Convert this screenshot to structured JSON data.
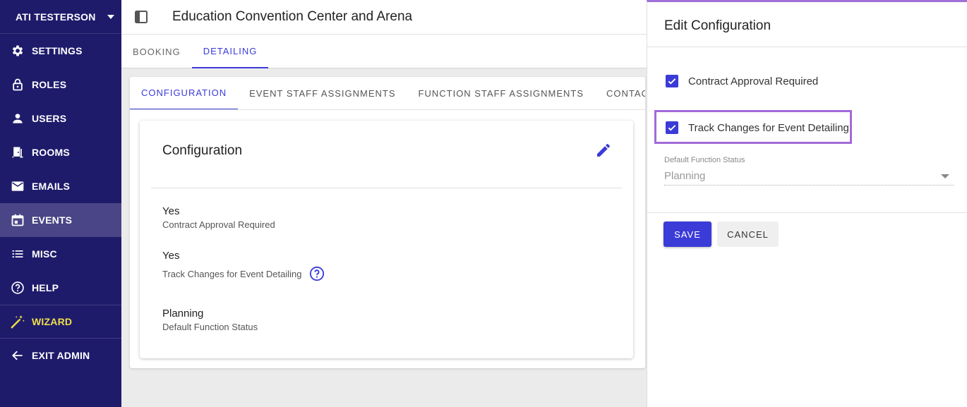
{
  "sidebar": {
    "user_name": "ATI TESTERSON",
    "items": [
      {
        "label": "SETTINGS",
        "icon": "gear-icon"
      },
      {
        "label": "ROLES",
        "icon": "lock-icon"
      },
      {
        "label": "USERS",
        "icon": "person-icon"
      },
      {
        "label": "ROOMS",
        "icon": "door-icon"
      },
      {
        "label": "EMAILS",
        "icon": "mail-icon"
      },
      {
        "label": "EVENTS",
        "icon": "calendar-icon"
      },
      {
        "label": "MISC",
        "icon": "list-icon"
      },
      {
        "label": "HELP",
        "icon": "help-icon"
      },
      {
        "label": "WIZARD",
        "icon": "magic-wand-icon"
      },
      {
        "label": "EXIT ADMIN",
        "icon": "arrow-left-icon"
      }
    ],
    "active": "EVENTS",
    "colors": {
      "background": "#1f1b6b",
      "active": "#4a4586",
      "wizard": "#f0df4a"
    }
  },
  "header": {
    "title": "Education Convention Center and Arena"
  },
  "top_tabs": [
    {
      "label": "BOOKING"
    },
    {
      "label": "DETAILING"
    }
  ],
  "sub_tabs": [
    {
      "label": "CONFIGURATION"
    },
    {
      "label": "EVENT STAFF ASSIGNMENTS"
    },
    {
      "label": "FUNCTION STAFF ASSIGNMENTS"
    },
    {
      "label": "CONTACT RO"
    }
  ],
  "config": {
    "title": "Configuration",
    "fields": [
      {
        "value": "Yes",
        "label": "Contract Approval Required"
      },
      {
        "value": "Yes",
        "label": "Track Changes for Event Detailing"
      },
      {
        "value": "Planning",
        "label": "Default Function Status"
      }
    ]
  },
  "drawer": {
    "title": "Edit Configuration",
    "checkboxes": [
      {
        "label": "Contract Approval Required",
        "checked": true
      },
      {
        "label": "Track Changes for Event Detailing",
        "checked": true
      }
    ],
    "select": {
      "label": "Default Function Status",
      "value": "Planning"
    },
    "save_label": "SAVE",
    "cancel_label": "CANCEL"
  },
  "colors": {
    "accent": "#3b3bd8",
    "highlight": "#a36ad9"
  }
}
